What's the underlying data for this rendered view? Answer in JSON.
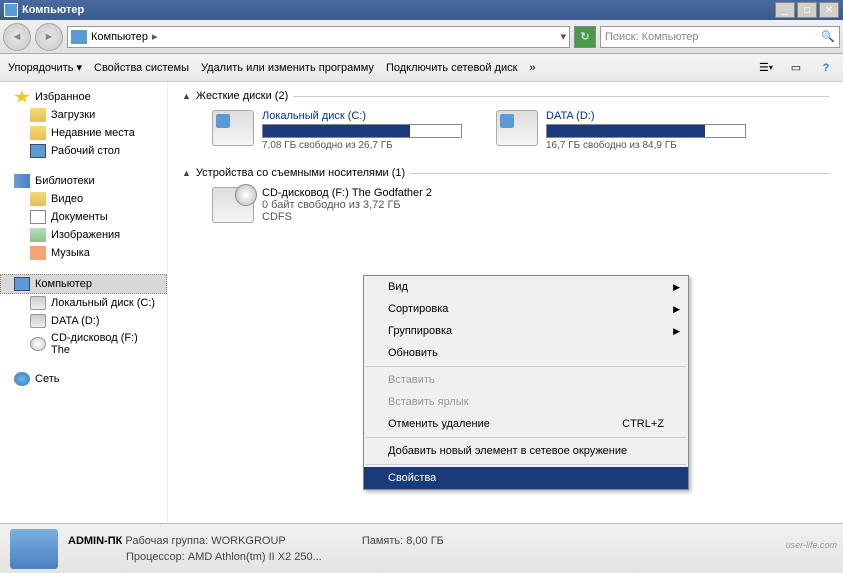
{
  "window": {
    "title": "Компьютер"
  },
  "nav": {
    "location": "Компьютер",
    "search_placeholder": "Поиск: Компьютер"
  },
  "toolbar": {
    "organize": "Упорядочить",
    "sysprops": "Свойства системы",
    "uninstall": "Удалить или изменить программу",
    "netdrive": "Подключить сетевой диск",
    "chev": "»"
  },
  "sidebar": {
    "favorites": "Избранное",
    "downloads": "Загрузки",
    "recent": "Недавние места",
    "desktop": "Рабочий стол",
    "libraries": "Библиотеки",
    "video": "Видео",
    "documents": "Документы",
    "pictures": "Изображения",
    "music": "Музыка",
    "computer": "Компьютер",
    "local_c": "Локальный диск (C:)",
    "data_d": "DATA (D:)",
    "cd_f": "CD-дисковод (F:) The",
    "network": "Сеть"
  },
  "content": {
    "hdd_header": "Жесткие диски (2)",
    "drives": [
      {
        "name": "Локальный диск (C:)",
        "free": "7,08 ГБ свободно из 26,7 ГБ",
        "pct": 74
      },
      {
        "name": "DATA (D:)",
        "free": "16,7 ГБ свободно из 84,9 ГБ",
        "pct": 80
      }
    ],
    "removable_header": "Устройства со съемными носителями (1)",
    "cd": {
      "name": "CD-дисковод (F:) The Godfather 2",
      "free": "0 байт свободно из 3,72 ГБ",
      "fs": "CDFS"
    }
  },
  "ctx": {
    "view": "Вид",
    "sort": "Сортировка",
    "group": "Группировка",
    "refresh": "Обновить",
    "paste": "Вставить",
    "paste_shortcut": "Вставить ярлык",
    "undo": "Отменить удаление",
    "undo_key": "CTRL+Z",
    "add_net": "Добавить новый элемент в сетевое окружение",
    "properties": "Свойства"
  },
  "status": {
    "name": "ADMIN-ПК",
    "workgroup_label": "Рабочая группа:",
    "workgroup": "WORKGROUP",
    "memory_label": "Память:",
    "memory": "8,00 ГБ",
    "cpu_label": "Процессор:",
    "cpu": "AMD Athlon(tm) II X2 250...",
    "watermark": "user-life.com"
  }
}
